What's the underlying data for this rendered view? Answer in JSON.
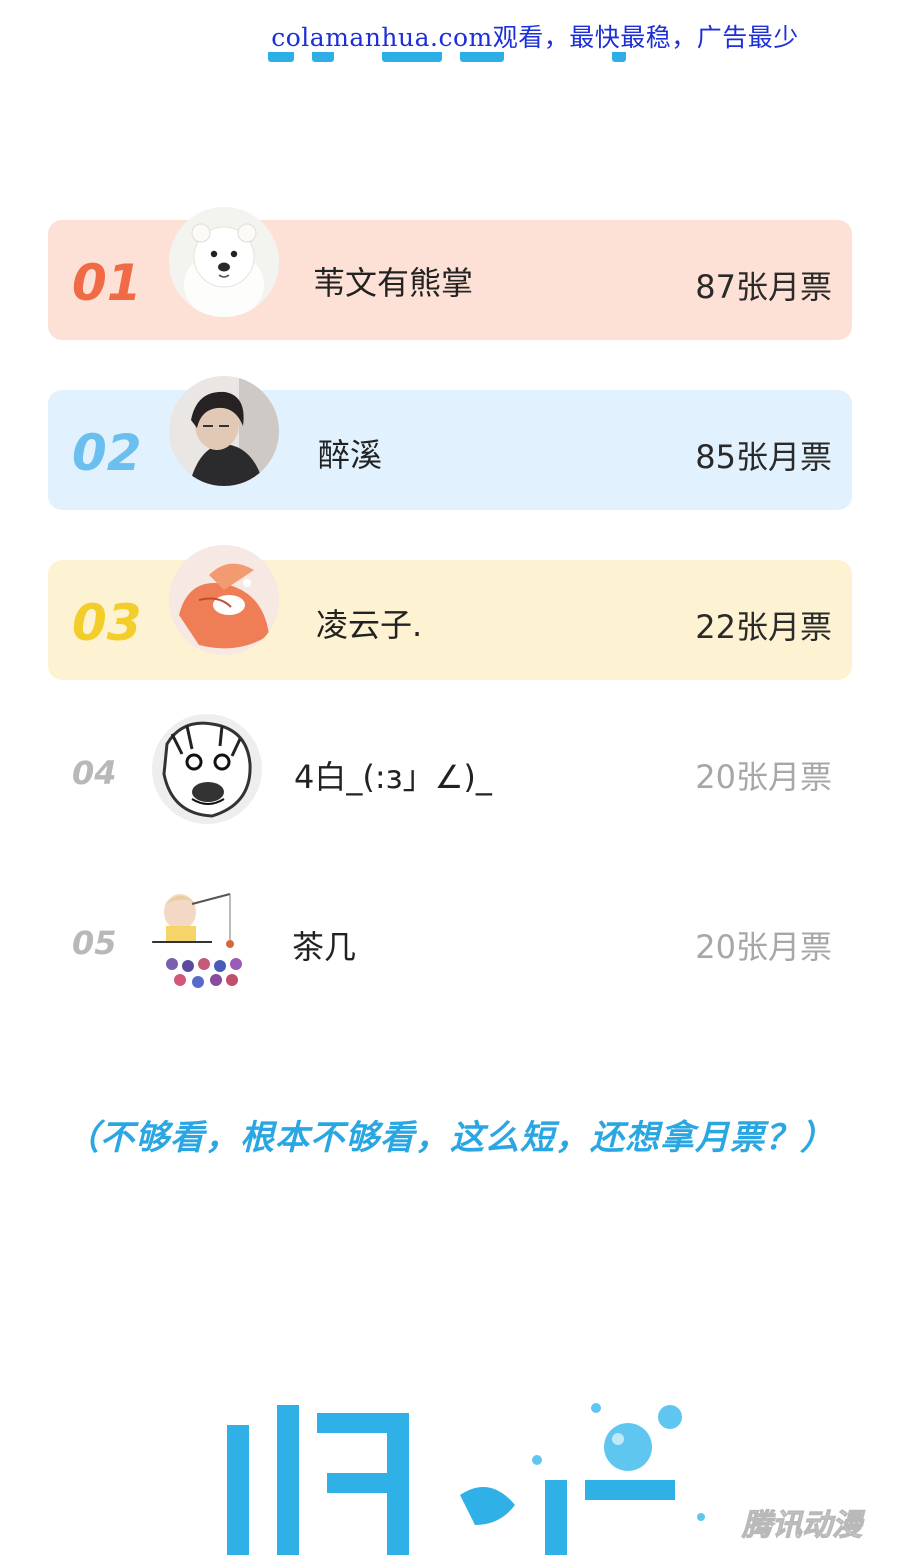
{
  "watermark": "colamanhua.com观看，最快最稳，广告最少",
  "colors": {
    "first_bg": "#fde0d6",
    "first_rank": "#ef6a45",
    "second_bg": "#e1f1fd",
    "second_rank": "#6bbfee",
    "third_bg": "#fdf2d2",
    "third_rank": "#f3cd2a",
    "accent": "#2aa7e2",
    "muted": "#a7a7a7"
  },
  "ranking": [
    {
      "rank": "01",
      "name": "苇文有熊掌",
      "votes": "87张月票",
      "avatar": "white-bear-avatar"
    },
    {
      "rank": "02",
      "name": "醉溪",
      "votes": "85张月票",
      "avatar": "dark-hair-person-avatar"
    },
    {
      "rank": "03",
      "name": "凌云子.",
      "votes": "22张月票",
      "avatar": "fox-girl-avatar"
    },
    {
      "rank": "04",
      "name": "4白_(:з」∠)_",
      "votes": "20张月票",
      "avatar": "manga-face-avatar"
    },
    {
      "rank": "05",
      "name": "茶几",
      "votes": "20张月票",
      "avatar": "chibi-fishing-avatar"
    }
  ],
  "caption": "（不够看，根本不够看，这么短，还想拿月票？）",
  "brand_stamp": "腾讯动漫"
}
